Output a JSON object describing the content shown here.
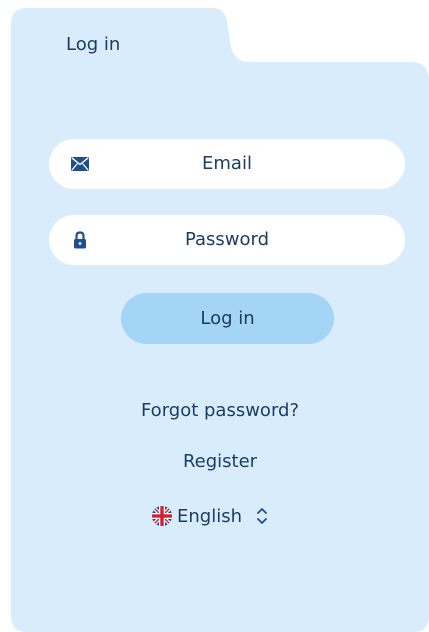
{
  "tab": {
    "title": "Log in"
  },
  "form": {
    "email": {
      "label": "Email",
      "icon": "envelope-icon"
    },
    "password": {
      "label": "Password",
      "icon": "lock-icon"
    },
    "submit_label": "Log in"
  },
  "links": {
    "forgot_password": "Forgot password?",
    "register": "Register"
  },
  "language": {
    "selected": "English",
    "icon": "uk-flag-icon"
  },
  "colors": {
    "panel_bg": "#d9ecfc",
    "field_bg": "#ffffff",
    "button_bg": "#a4d5f7",
    "text": "#1a3d63",
    "icon": "#1f4f8f"
  }
}
